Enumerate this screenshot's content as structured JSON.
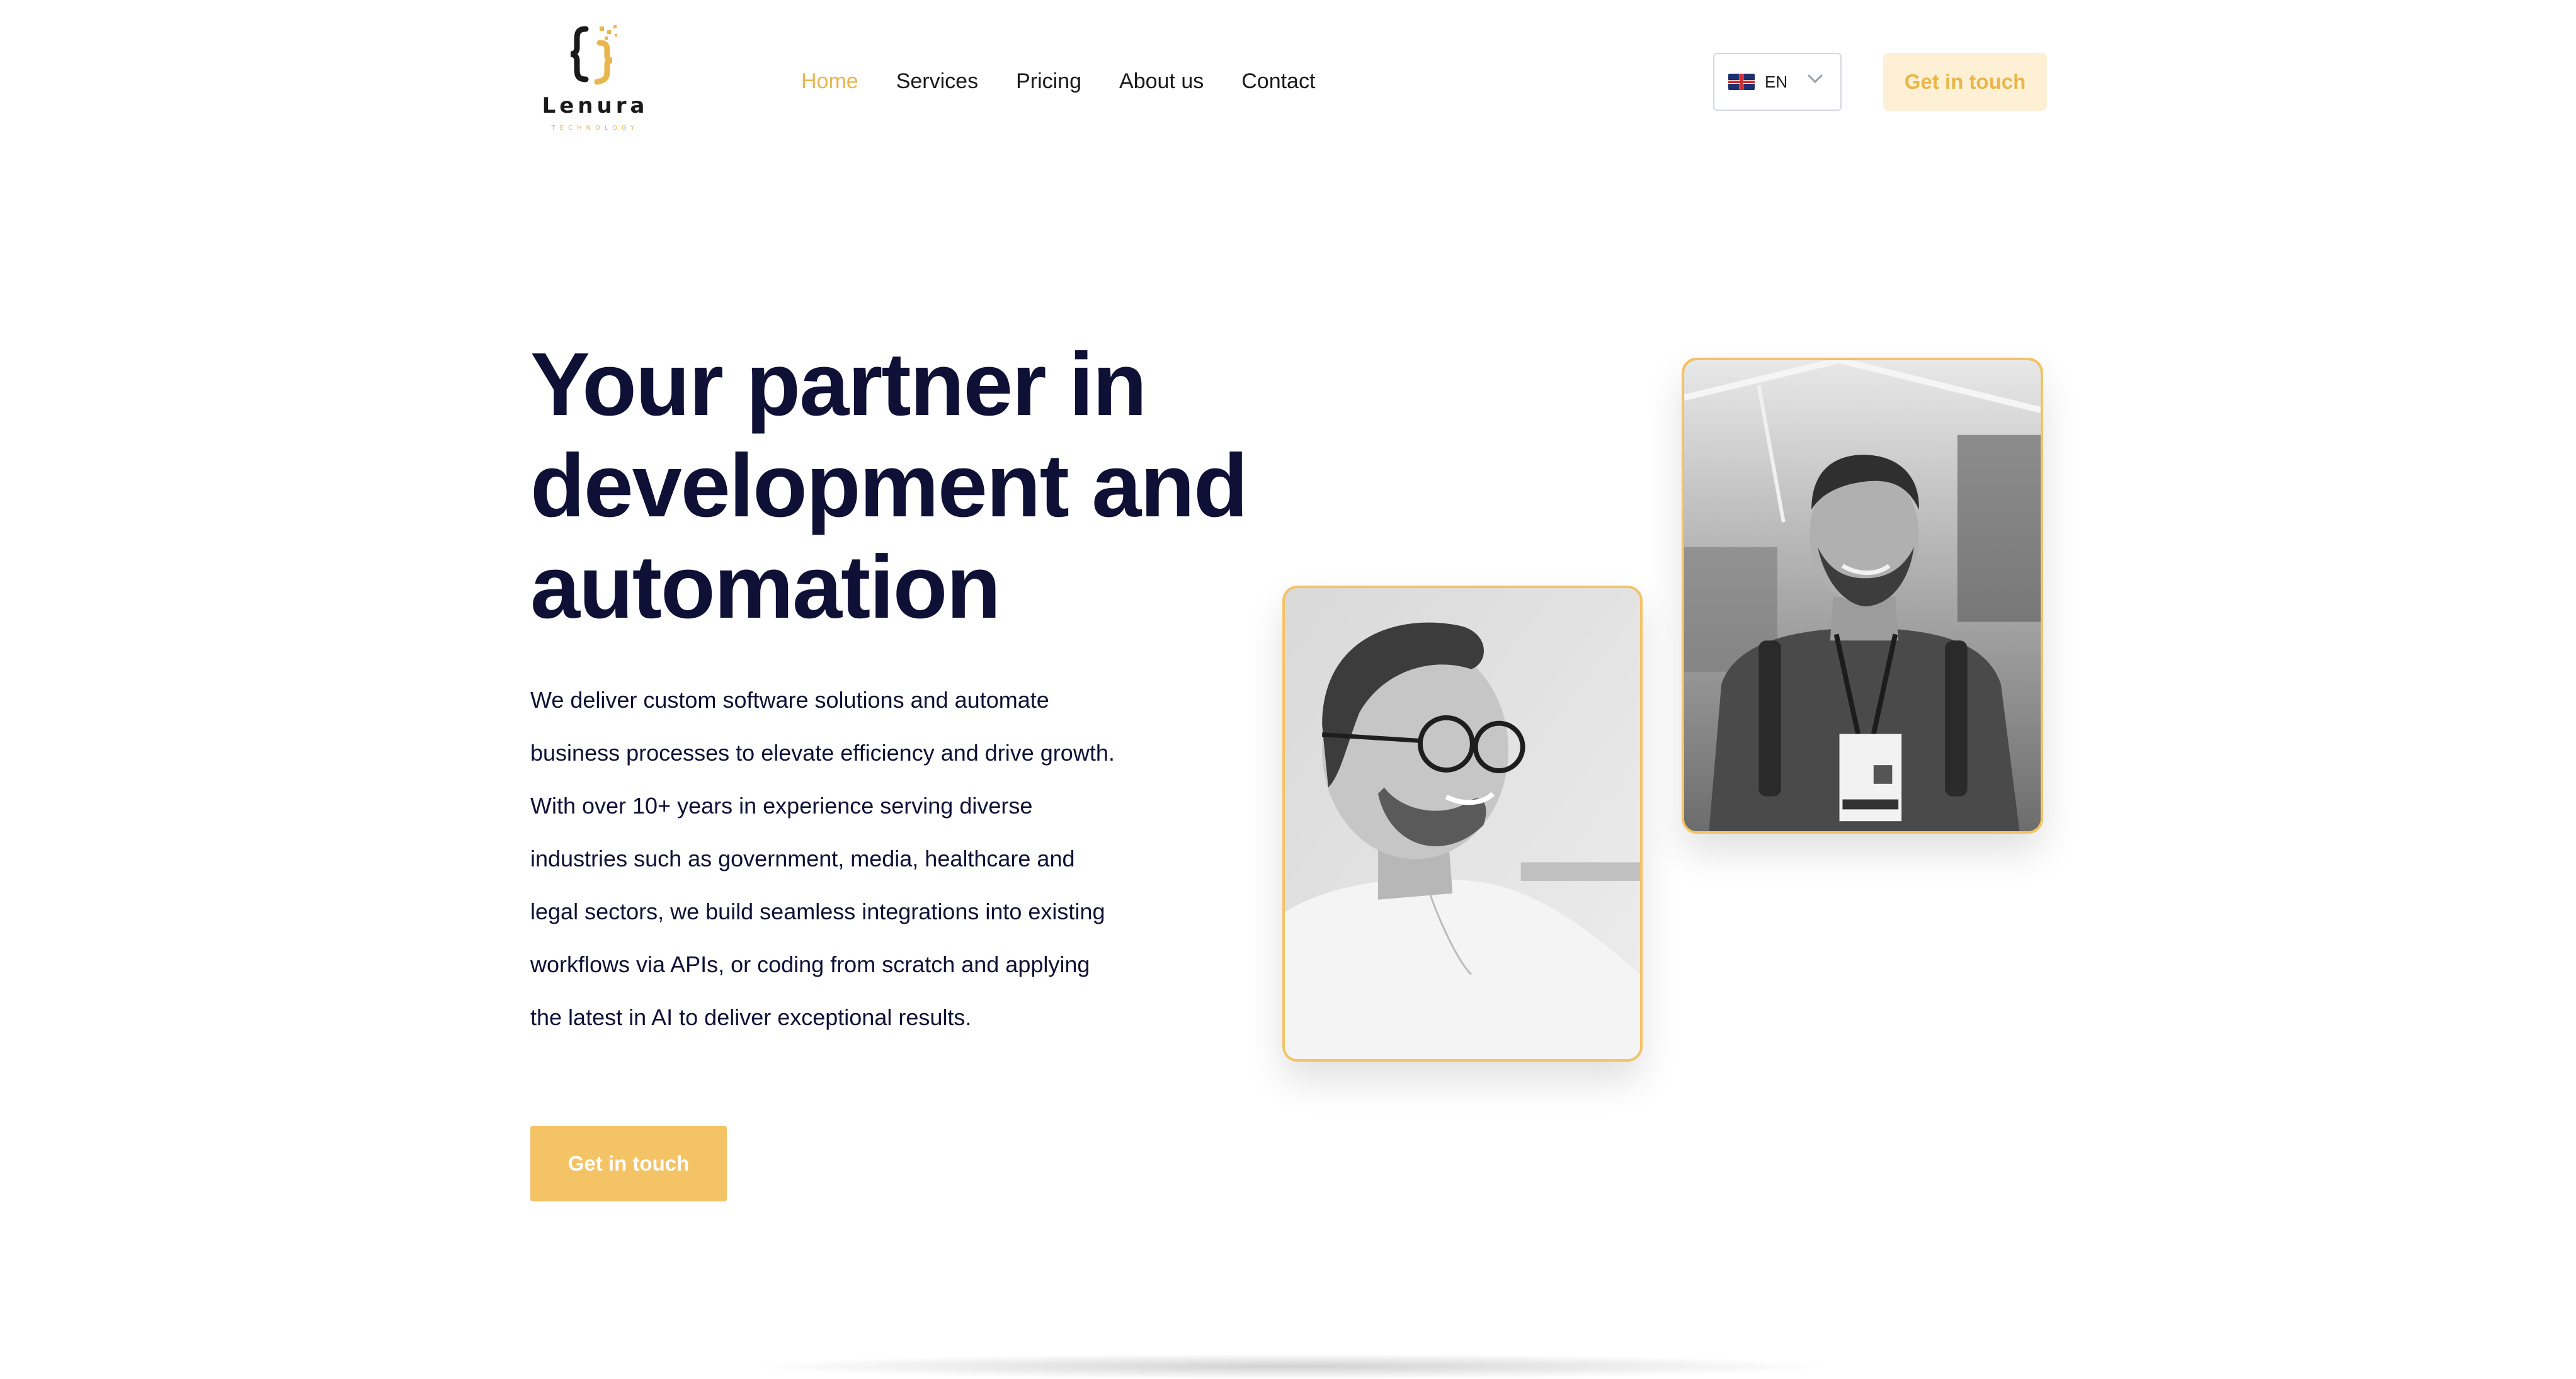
{
  "brand": {
    "name": "Lenura",
    "subtitle": "TECHNOLOGY",
    "icon": "code-braces-logo-icon",
    "accent_color": "#e8b64c"
  },
  "nav": {
    "items": [
      {
        "label": "Home",
        "active": true
      },
      {
        "label": "Services",
        "active": false
      },
      {
        "label": "Pricing",
        "active": false
      },
      {
        "label": "About us",
        "active": false
      },
      {
        "label": "Contact",
        "active": false
      }
    ]
  },
  "language": {
    "selected": "EN",
    "flag_icon": "uk-flag-icon",
    "chevron_icon": "chevron-down-icon"
  },
  "header": {
    "cta_label": "Get in touch"
  },
  "hero": {
    "title_lines": [
      "Your partner in",
      "development and",
      "automation"
    ],
    "description": "We deliver custom software solutions and automate business processes to elevate efficiency and drive growth. With over 10+ years in experience serving diverse industries such as government, media, healthcare and legal sectors, we build seamless integrations into existing workflows via APIs, or coding from scratch and applying the latest in AI to deliver exceptional results.",
    "cta_label": "Get in touch"
  },
  "colors": {
    "primary_text": "#0f1035",
    "accent": "#f3c366",
    "accent_light": "#fdf0d4"
  }
}
